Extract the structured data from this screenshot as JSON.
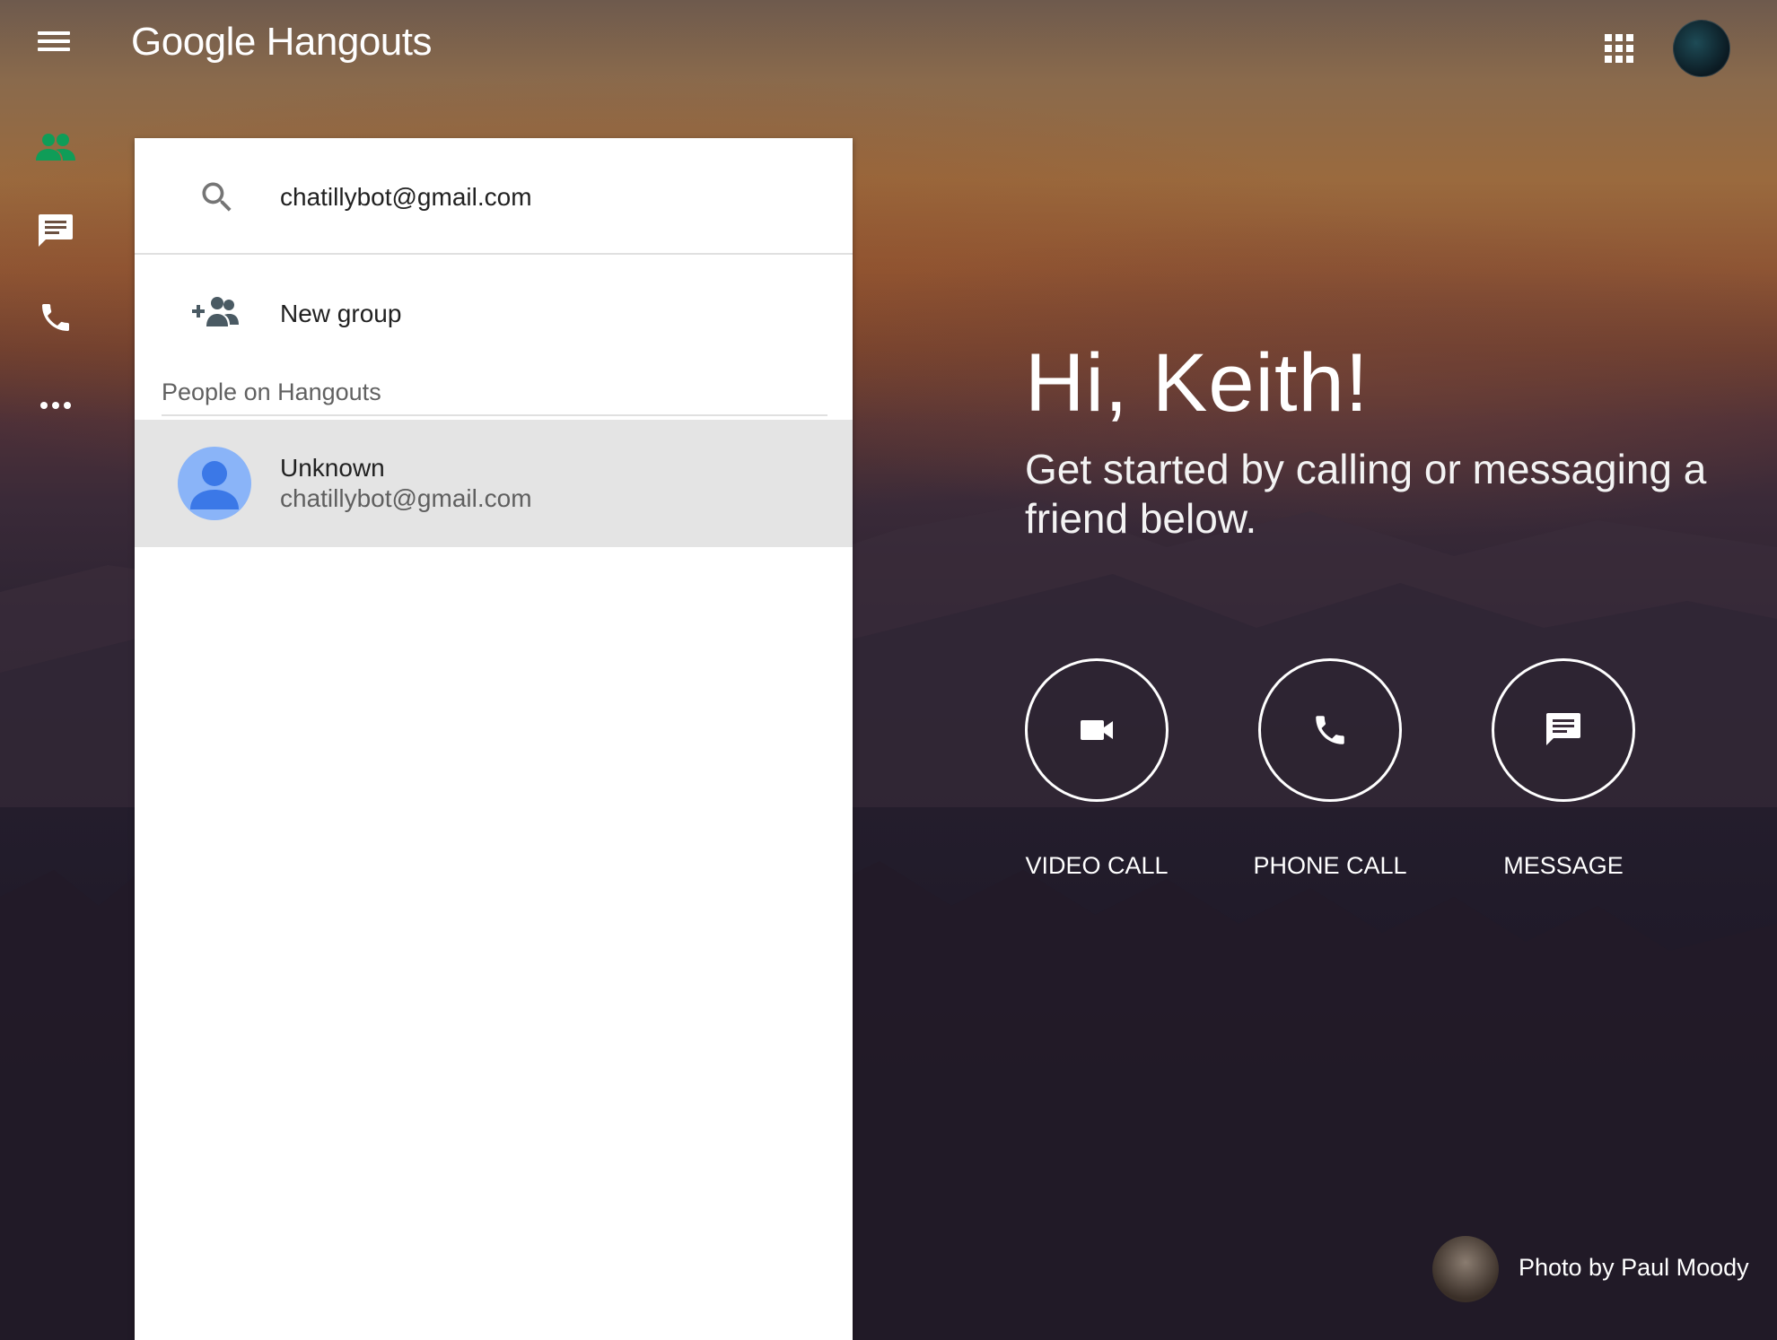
{
  "app": {
    "logo_google": "Google",
    "logo_product": "Hangouts"
  },
  "nav": {
    "items": [
      {
        "name": "contacts",
        "icon": "people-icon",
        "active": true
      },
      {
        "name": "conversations",
        "icon": "chat-icon",
        "active": false
      },
      {
        "name": "phone",
        "icon": "phone-icon",
        "active": false
      },
      {
        "name": "more",
        "icon": "more-horiz-icon",
        "active": false
      }
    ]
  },
  "search": {
    "value": "chatillybot@gmail.com"
  },
  "new_group": {
    "label": "New group"
  },
  "people_section": {
    "label": "People on Hangouts",
    "contacts": [
      {
        "name": "Unknown",
        "email": "chatillybot@gmail.com"
      }
    ]
  },
  "welcome": {
    "greeting": "Hi, Keith!",
    "subtitle": "Get started by calling or messaging a friend below."
  },
  "actions": {
    "video_call": "VIDEO CALL",
    "phone_call": "PHONE CALL",
    "message": "MESSAGE"
  },
  "credit": {
    "text": "Photo by Paul Moody"
  },
  "colors": {
    "accent_green": "#0f9d58",
    "icon_gray": "#4a5a63",
    "avatar_blue": "#8ab4f8",
    "avatar_dark_blue": "#4285f4"
  }
}
